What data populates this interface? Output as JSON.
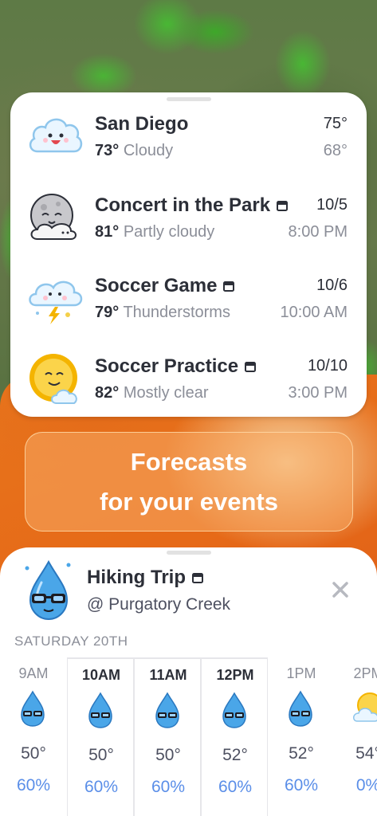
{
  "events": [
    {
      "title": "San Diego",
      "temp": "73°",
      "condition": "Cloudy",
      "right_top": "75°",
      "right_bottom": "68°",
      "has_calendar": false,
      "icon": "happy-cloud-icon"
    },
    {
      "title": "Concert in the Park",
      "temp": "81°",
      "condition": "Partly cloudy",
      "right_top": "10/5",
      "right_bottom": "8:00 PM",
      "has_calendar": true,
      "icon": "moon-cloud-icon"
    },
    {
      "title": "Soccer Game",
      "temp": "79°",
      "condition": "Thunderstorms",
      "right_top": "10/6",
      "right_bottom": "10:00 AM",
      "has_calendar": true,
      "icon": "storm-cloud-icon"
    },
    {
      "title": "Soccer Practice",
      "temp": "82°",
      "condition": "Mostly clear",
      "right_top": "10/10",
      "right_bottom": "3:00 PM",
      "has_calendar": true,
      "icon": "sun-cloud-icon"
    }
  ],
  "promo": {
    "line1": "Forecasts",
    "line2": "for your events"
  },
  "detail": {
    "title": "Hiking Trip",
    "location": "@ Purgatory Creek",
    "date_label": "SATURDAY 20TH",
    "hours": [
      {
        "time": "9AM",
        "temp": "50°",
        "precip": "60%",
        "icon": "raindrop-glasses-icon"
      },
      {
        "time": "10AM",
        "temp": "50°",
        "precip": "60%",
        "icon": "raindrop-glasses-icon"
      },
      {
        "time": "11AM",
        "temp": "50°",
        "precip": "60%",
        "icon": "raindrop-glasses-icon"
      },
      {
        "time": "12PM",
        "temp": "52°",
        "precip": "60%",
        "icon": "raindrop-glasses-icon"
      },
      {
        "time": "1PM",
        "temp": "52°",
        "precip": "60%",
        "icon": "raindrop-glasses-icon"
      },
      {
        "time": "2PM",
        "temp": "54°",
        "precip": "0%",
        "icon": "sun-cloud-icon"
      }
    ]
  },
  "colors": {
    "accent": "#5a8ee8",
    "orange": "#e8751c",
    "text": "#2c2f38",
    "muted": "#8b8e98"
  }
}
